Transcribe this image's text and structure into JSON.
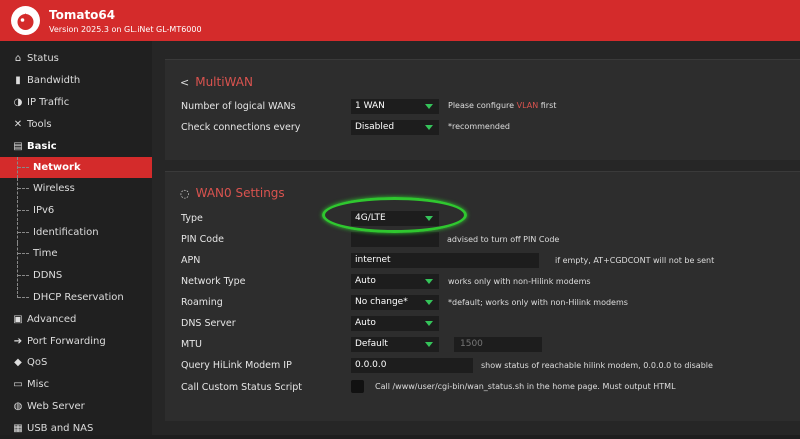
{
  "header": {
    "brand": "Tomato64",
    "version": "Version 2025.3 on GL.iNet GL-MT6000"
  },
  "sidebar": {
    "items": [
      {
        "icon": "home-icon",
        "glyph": "⌂",
        "label": "Status"
      },
      {
        "icon": "bar-chart-icon",
        "glyph": "▮",
        "label": "Bandwidth"
      },
      {
        "icon": "pie-chart-icon",
        "glyph": "◑",
        "label": "IP Traffic"
      },
      {
        "icon": "tools-icon",
        "glyph": "✕",
        "label": "Tools"
      },
      {
        "icon": "server-icon",
        "glyph": "▤",
        "label": "Basic"
      }
    ],
    "sub_items": [
      {
        "label": "Network"
      },
      {
        "label": "Wireless"
      },
      {
        "label": "IPv6"
      },
      {
        "label": "Identification"
      },
      {
        "label": "Time"
      },
      {
        "label": "DDNS"
      },
      {
        "label": "DHCP Reservation"
      }
    ],
    "items_after": [
      {
        "icon": "advanced-icon",
        "glyph": "▣",
        "label": "Advanced"
      },
      {
        "icon": "port-forwarding-icon",
        "glyph": "➔",
        "label": "Port Forwarding"
      },
      {
        "icon": "qos-icon",
        "glyph": "◆",
        "label": "QoS"
      },
      {
        "icon": "misc-icon",
        "glyph": "▭",
        "label": "Misc"
      },
      {
        "icon": "globe-icon",
        "glyph": "◍",
        "label": "Web Server"
      },
      {
        "icon": "usb-icon",
        "glyph": "▦",
        "label": "USB and NAS"
      }
    ]
  },
  "multiwan": {
    "title": "MultiWAN",
    "rows": [
      {
        "label": "Number of logical WANs",
        "value": "1 WAN",
        "note_pre": "Please configure ",
        "note_hl": "VLAN",
        "note_post": " first"
      },
      {
        "label": "Check connections every",
        "value": "Disabled",
        "note": "*recommended"
      }
    ]
  },
  "wan0": {
    "title": "WAN0 Settings",
    "type": {
      "label": "Type",
      "value": "4G/LTE"
    },
    "pin": {
      "label": "PIN Code",
      "value": "",
      "note": "advised to turn off PIN Code"
    },
    "apn": {
      "label": "APN",
      "value": "internet",
      "note": "if empty, AT+CGDCONT will not be sent"
    },
    "network_type": {
      "label": "Network Type",
      "value": "Auto",
      "note": "works only with non-Hilink modems"
    },
    "roaming": {
      "label": "Roaming",
      "value": "No change*",
      "note": "*default; works only with non-Hilink modems"
    },
    "dns": {
      "label": "DNS Server",
      "value": "Auto"
    },
    "mtu": {
      "label": "MTU",
      "value": "Default",
      "input": "1500"
    },
    "hilink": {
      "label": "Query HiLink Modem IP",
      "value": "0.0.0.0",
      "note": "show status of reachable hilink modem, 0.0.0.0 to disable"
    },
    "status_script": {
      "label": "Call Custom Status Script",
      "note": "Call /www/user/cgi-bin/wan_status.sh in the home page. Must output HTML"
    }
  }
}
